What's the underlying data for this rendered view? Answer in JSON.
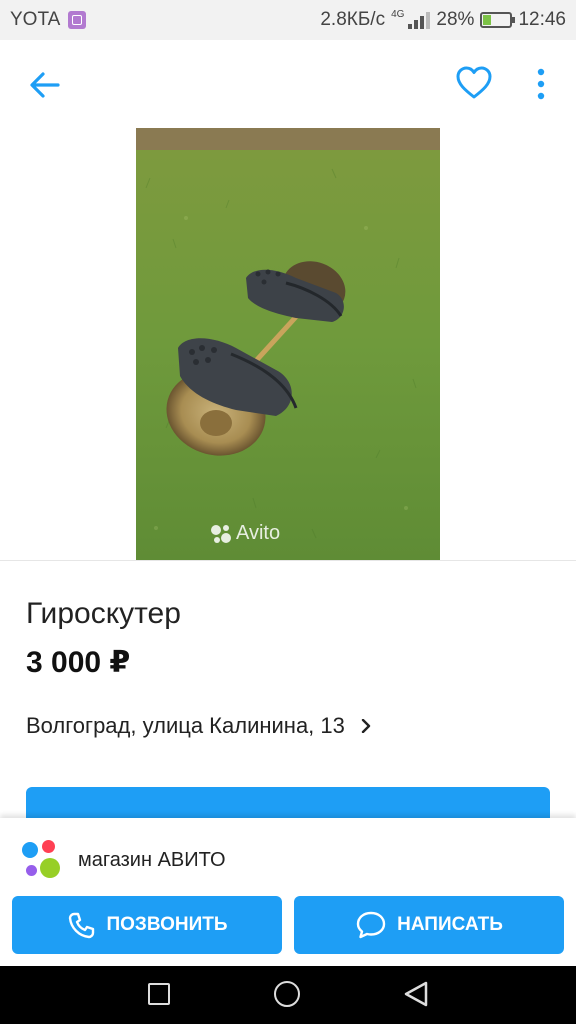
{
  "status_bar": {
    "carrier": "YOTA",
    "speed": "2.8КБ/с",
    "network": "4G",
    "battery_percent": "28%",
    "battery_level": 0.28,
    "time": "12:46"
  },
  "toolbar": {
    "icons": [
      "arrow-left-icon",
      "heart-icon",
      "more-vertical-icon"
    ],
    "accent": "#1e9ef5"
  },
  "listing": {
    "title": "Гироскутер",
    "price": "3 000 ₽",
    "address": "Волгоград, улица Калинина, 13",
    "watermark": "Avito"
  },
  "seller": {
    "name": "магазин АВИТО",
    "logo_colors": [
      "#1e9ef5",
      "#ff4053",
      "#965eeb",
      "#97cf26"
    ]
  },
  "actions": {
    "call_label": "ПОЗВОНИТЬ",
    "write_label": "НАПИСАТЬ"
  }
}
